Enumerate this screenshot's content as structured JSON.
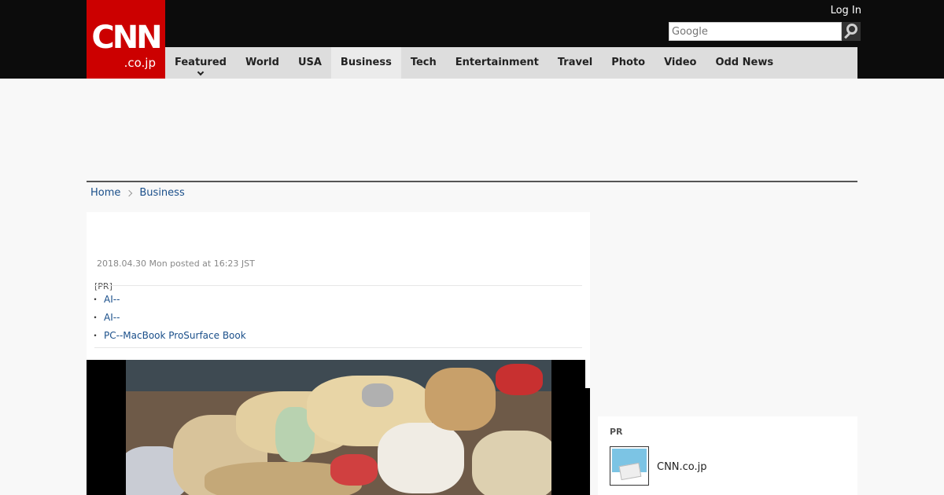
{
  "header": {
    "logo": "CNN",
    "logo_sub": ".co.jp",
    "login": "Log In",
    "search_placeholder": "Google"
  },
  "nav": {
    "items": [
      {
        "label": "Featured",
        "has_dropdown": true
      },
      {
        "label": "World"
      },
      {
        "label": "USA"
      },
      {
        "label": "Business",
        "active": true
      },
      {
        "label": "Tech"
      },
      {
        "label": "Entertainment"
      },
      {
        "label": "Travel"
      },
      {
        "label": "Photo"
      },
      {
        "label": "Video"
      },
      {
        "label": "Odd News"
      }
    ]
  },
  "breadcrumb": [
    "Home",
    "Business"
  ],
  "article": {
    "date": "2018.04.30 Mon posted at 16:23 JST",
    "pr_label": "[PR]",
    "pr_links": [
      "AI--",
      "AI--",
      "PC--MacBook ProSurface Book"
    ]
  },
  "sidebar": {
    "pr_label": "PR",
    "item_name": "CNN.co.jp"
  },
  "colors": {
    "brand_red": "#cc0000",
    "header_bg": "#0c0c0c",
    "nav_bg": "#dddddd",
    "link": "#1a4f8a"
  }
}
